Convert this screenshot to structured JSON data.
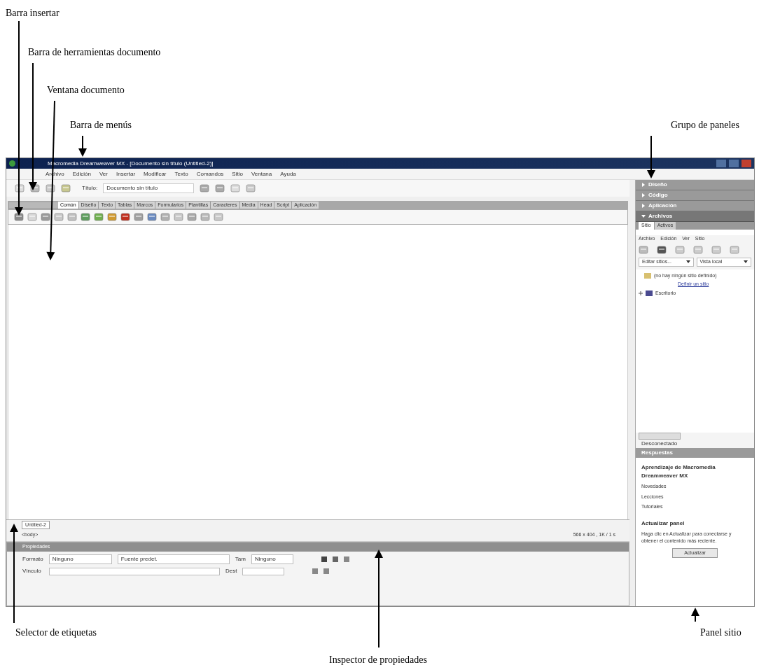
{
  "annotations": [
    {
      "label": "Barra insertar"
    },
    {
      "label": "Barra de herramientas documento"
    },
    {
      "label": "Ventana documento"
    },
    {
      "label": "Barra de menús"
    },
    {
      "label": "Grupo de paneles"
    },
    {
      "label": "Selector de etiquetas"
    },
    {
      "label": "Panel sitio"
    },
    {
      "label": "Inspector de propiedades"
    }
  ],
  "window": {
    "title": "Macromedia Dreamweaver MX - [Documento sin título (Untitled-2)]"
  },
  "menu_bar": [
    "Archivo",
    "Edición",
    "Ver",
    "Insertar",
    "Modificar",
    "Texto",
    "Comandos",
    "Sitio",
    "Ventana",
    "Ayuda"
  ],
  "document_toolbar": {
    "title_label": "Título:",
    "title_value": "Documento sin título"
  },
  "insert_bar": {
    "tabs": [
      {
        "label": "Común",
        "selected": true
      },
      {
        "label": "Diseño",
        "selected": false
      },
      {
        "label": "Texto",
        "selected": false
      },
      {
        "label": "Tablas",
        "selected": false
      },
      {
        "label": "Marcos",
        "selected": false
      },
      {
        "label": "Formularios",
        "selected": false
      },
      {
        "label": "Plantillas",
        "selected": false
      },
      {
        "label": "Caracteres",
        "selected": false
      },
      {
        "label": "Media",
        "selected": false
      },
      {
        "label": "Head",
        "selected": false
      },
      {
        "label": "Script",
        "selected": false
      },
      {
        "label": "Aplicación",
        "selected": false
      }
    ]
  },
  "status_bar": {
    "document_tab": "Untitled-2",
    "tag": "<body>",
    "size": "566 x 404 , 1K / 1 s"
  },
  "property_inspector": {
    "title": "Propiedades",
    "format_label": "Formato",
    "format_value": "Ninguno",
    "font_value": "Fuente predet.",
    "size_label": "Tam",
    "size_value": "Ninguno",
    "link_label": "Vínculo",
    "target_label": "Dest"
  },
  "panels": {
    "groups": [
      {
        "title": "Diseño",
        "expanded": false
      },
      {
        "title": "Código",
        "expanded": false
      },
      {
        "title": "Aplicación",
        "expanded": false
      },
      {
        "title": "Archivos",
        "expanded": true
      }
    ],
    "files_tabs": [
      {
        "label": "Sitio",
        "selected": true
      },
      {
        "label": "Activos",
        "selected": false
      }
    ],
    "files_menus": [
      "Archivo",
      "Edición",
      "Ver",
      "Sitio"
    ],
    "site_select": "Editar sitios...",
    "view_select": "Vista local",
    "tree": [
      {
        "label": "(no hay ningún sitio definido)",
        "link": "Definir un sitio"
      },
      {
        "label": "Escritorio"
      }
    ],
    "connection": "Desconectado",
    "answers": {
      "title": "Respuestas",
      "heading": "Aprendizaje de Macromedia Dreamweaver MX",
      "items": [
        "Novedades",
        "Lecciones",
        "Tutoriales"
      ],
      "update_heading": "Actualizar panel",
      "update_text": "Haga clic en Actualizar para conectarse y obtener el contenido más reciente.",
      "button": "Actualizar"
    }
  }
}
